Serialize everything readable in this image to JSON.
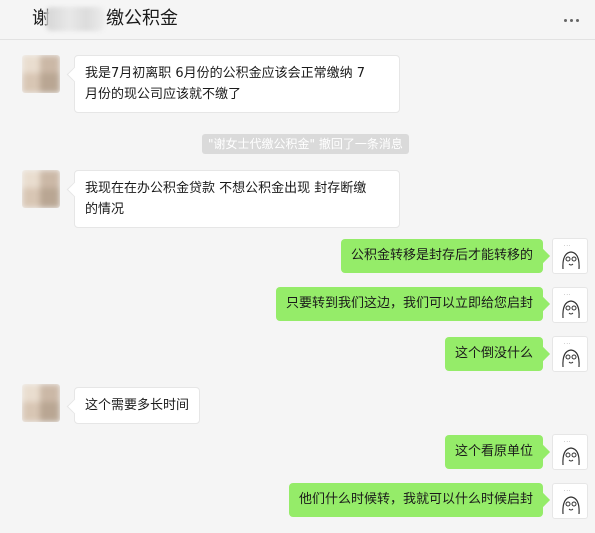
{
  "header": {
    "title_left": "谢",
    "title_right": "缴公积金"
  },
  "colors": {
    "sent_bubble": "#95ec69",
    "received_bubble": "#ffffff",
    "background": "#f5f5f5"
  },
  "messages": [
    {
      "side": "left",
      "text_line1": "我是7月初离职  6月份的公积金应该会正常缴纳  7",
      "text_line2": "月份的现公司应该就不缴了"
    },
    {
      "side": "system",
      "text": "\"谢女士代缴公积金\" 撤回了一条消息"
    },
    {
      "side": "left",
      "text_line1": "我现在在办公积金贷款  不想公积金出现 封存断缴",
      "text_line2": "的情况"
    },
    {
      "side": "right",
      "text": "公积金转移是封存后才能转移的"
    },
    {
      "side": "right",
      "text": "只要转到我们这边，我们可以立即给您启封"
    },
    {
      "side": "right",
      "text": "这个倒没什么"
    },
    {
      "side": "left",
      "text": "这个需要多长时间"
    },
    {
      "side": "right",
      "text": "这个看原单位"
    },
    {
      "side": "right",
      "text": "他们什么时候转，我就可以什么时候启封"
    }
  ]
}
